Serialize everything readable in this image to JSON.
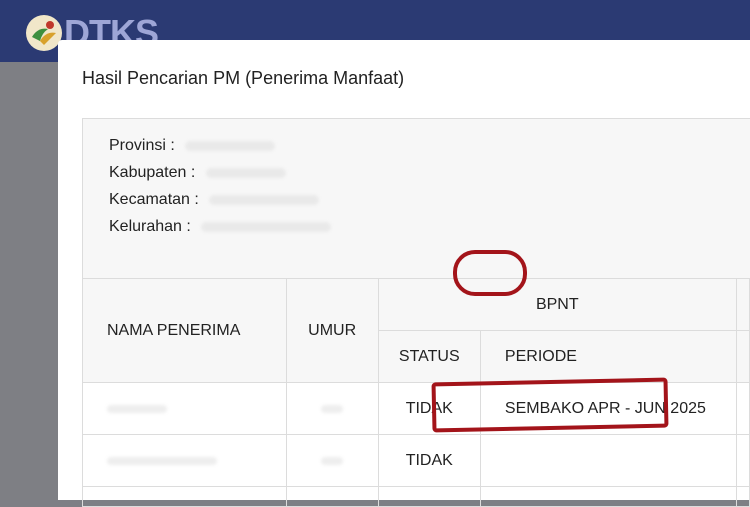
{
  "app": {
    "logo_text": "DTKS"
  },
  "modal": {
    "title": "Hasil Pencarian PM (Penerima Manfaat)",
    "info": {
      "provinsi_label": "Provinsi :",
      "kabupaten_label": "Kabupaten :",
      "kecamatan_label": "Kecamatan :",
      "kelurahan_label": "Kelurahan :"
    },
    "table": {
      "col_nama": "NAMA PENERIMA",
      "col_umur": "UMUR",
      "group_bpnt": "BPNT",
      "col_status": "STATUS",
      "col_periode": "PERIODE",
      "rows": [
        {
          "status": "TIDAK",
          "periode": "SEMBAKO APR - JUN 2025"
        },
        {
          "status": "TIDAK",
          "periode": ""
        }
      ]
    }
  },
  "colors": {
    "topbar": "#2b3a73",
    "annotation": "#a3141a",
    "backdrop": "#7d7f85"
  }
}
